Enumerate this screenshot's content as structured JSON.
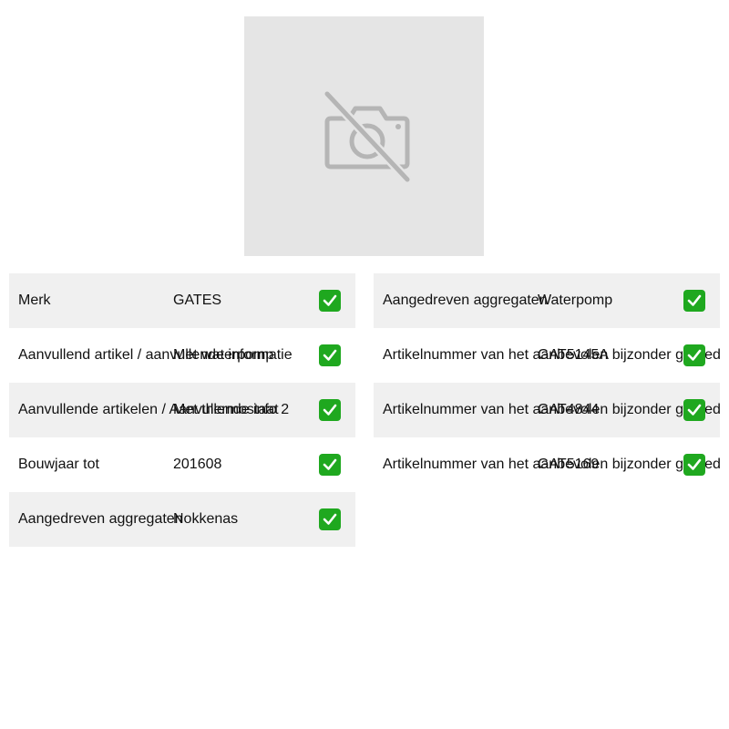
{
  "image": {
    "icon": "camera-off-icon"
  },
  "left_table": [
    {
      "label": "Merk",
      "value": "GATES"
    },
    {
      "label": "Aanvullend artikel / aanvullende informatie",
      "value": "Met waterpomp"
    },
    {
      "label": "Aanvullende artikelen / Aanvullende info 2",
      "value": "Met thermostaat"
    },
    {
      "label": "Bouwjaar tot",
      "value": "201608"
    },
    {
      "label": "Aangedreven aggregaten",
      "value": "Nokkenas"
    }
  ],
  "right_table": [
    {
      "label": "Aangedreven aggregaten",
      "value": "Waterpomp"
    },
    {
      "label": "Artikelnummer van het aanbevolen bijzonder gereedschap",
      "value": "GAT5145A"
    },
    {
      "label": "Artikelnummer van het aanbevolen bijzonder gereedschap",
      "value": "GAT4844"
    },
    {
      "label": "Artikelnummer van het aanbevolen bijzonder gereedschap",
      "value": "GAT5169"
    }
  ],
  "colors": {
    "placeholder_bg": "#e5e5e5",
    "row_shaded": "#f0f0f0",
    "check_green": "#1fa81f"
  },
  "check_icon": "check-mark-icon"
}
